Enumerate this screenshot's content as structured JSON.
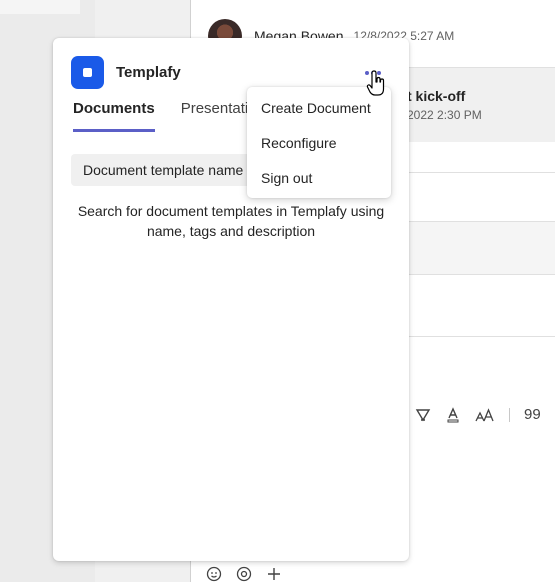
{
  "background": {
    "message": {
      "author": "Megan Bowen",
      "timestamp": "12/8/2022 5:27 AM"
    },
    "meeting_card": {
      "title": "t kick-off",
      "date": "2022 2:30 PM"
    },
    "toolbar": {
      "quote_label": "99"
    }
  },
  "popup": {
    "app_name": "Templafy",
    "more_icon": "more-horizontal-icon",
    "tabs": [
      {
        "label": "Documents",
        "active": true
      },
      {
        "label": "Presentation",
        "active": false
      }
    ],
    "search": {
      "value": "Document template name"
    },
    "helper_text": "Search for document templates in Templafy using name, tags and description"
  },
  "menu": {
    "items": [
      {
        "label": "Create Document"
      },
      {
        "label": "Reconfigure"
      },
      {
        "label": "Sign out"
      }
    ]
  },
  "colors": {
    "accent": "#5b5fc7",
    "logo": "#1a5ae8"
  }
}
